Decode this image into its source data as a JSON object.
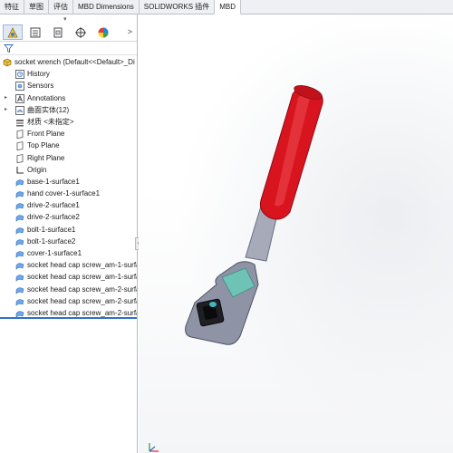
{
  "tabs": [
    {
      "label": "特征"
    },
    {
      "label": "草图"
    },
    {
      "label": "评估"
    },
    {
      "label": "MBD Dimensions"
    },
    {
      "label": "SOLIDWORKS 插件"
    },
    {
      "label": "MBD"
    }
  ],
  "panel": {
    "iconbar": [
      "feature-manager-icon",
      "property-manager-icon",
      "configuration-manager-icon",
      "dimxpert-icon",
      "display-manager-icon"
    ],
    "more_glyph": ">",
    "tree": {
      "root": "socket wrench  (Default<<Default>_Di",
      "items": [
        {
          "label": "History",
          "icon": "history-icon",
          "expander": ""
        },
        {
          "label": "Sensors",
          "icon": "sensors-icon",
          "expander": ""
        },
        {
          "label": "Annotations",
          "icon": "annotations-icon",
          "expander": "▸"
        },
        {
          "label": "曲面实体(12)",
          "icon": "surface-bodies-icon",
          "expander": "▸"
        },
        {
          "label": "材质 <未指定>",
          "icon": "material-icon",
          "expander": ""
        },
        {
          "label": "Front Plane",
          "icon": "plane-icon",
          "expander": ""
        },
        {
          "label": "Top Plane",
          "icon": "plane-icon",
          "expander": ""
        },
        {
          "label": "Right Plane",
          "icon": "plane-icon",
          "expander": ""
        },
        {
          "label": "Origin",
          "icon": "origin-icon",
          "expander": ""
        },
        {
          "label": "base-1-surface1",
          "icon": "imported-surface-icon",
          "expander": ""
        },
        {
          "label": "hand cover-1-surface1",
          "icon": "imported-surface-icon",
          "expander": ""
        },
        {
          "label": "drive-2-surface1",
          "icon": "imported-surface-icon",
          "expander": ""
        },
        {
          "label": "drive-2-surface2",
          "icon": "imported-surface-icon",
          "expander": ""
        },
        {
          "label": "bolt-1-surface1",
          "icon": "imported-surface-icon",
          "expander": ""
        },
        {
          "label": "bolt-1-surface2",
          "icon": "imported-surface-icon",
          "expander": ""
        },
        {
          "label": "cover-1-surface1",
          "icon": "imported-surface-icon",
          "expander": ""
        },
        {
          "label": "socket head cap screw_am-1-surfa",
          "icon": "imported-surface-icon",
          "expander": ""
        },
        {
          "label": "socket head cap screw_am-1-surfa",
          "icon": "imported-surface-icon",
          "expander": ""
        },
        {
          "label": "socket head cap screw_am-2-surfa",
          "icon": "imported-surface-icon",
          "expander": ""
        },
        {
          "label": "socket head cap screw_am-2-surfa",
          "icon": "imported-surface-icon",
          "expander": ""
        },
        {
          "label": "socket head cap screw_am-2-surfa",
          "icon": "imported-surface-icon",
          "expander": ""
        }
      ]
    }
  },
  "colors": {
    "handle_red": "#d8141f",
    "body_gray": "#8f93a6",
    "accent_teal": "#6fc2b6",
    "selection_blue": "#2f6fd1"
  }
}
